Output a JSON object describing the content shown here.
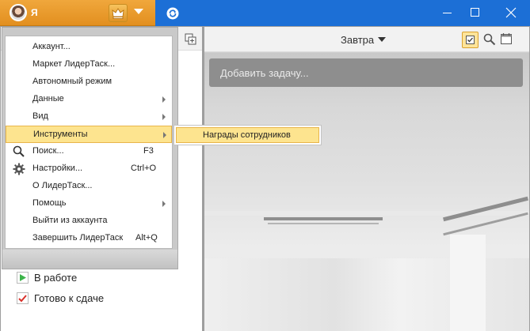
{
  "titlebar": {
    "user_name": "Я",
    "crown_icon": "crown-icon",
    "sync_icon": "sync-icon"
  },
  "menu": {
    "items": [
      {
        "label": "Аккаунт...",
        "shortcut": "",
        "submenu": false,
        "icon": ""
      },
      {
        "label": "Маркет ЛидерТаск...",
        "shortcut": "",
        "submenu": false,
        "icon": ""
      },
      {
        "label": "Автономный режим",
        "shortcut": "",
        "submenu": false,
        "icon": ""
      },
      {
        "label": "Данные",
        "shortcut": "",
        "submenu": true,
        "icon": ""
      },
      {
        "label": "Вид",
        "shortcut": "",
        "submenu": true,
        "icon": ""
      },
      {
        "label": "Инструменты",
        "shortcut": "",
        "submenu": true,
        "icon": "",
        "highlighted": true
      },
      {
        "label": "Поиск...",
        "shortcut": "F3",
        "submenu": false,
        "icon": "search-icon"
      },
      {
        "label": "Настройки...",
        "shortcut": "Ctrl+O",
        "submenu": false,
        "icon": "gear-icon"
      },
      {
        "label": "О ЛидерТаск...",
        "shortcut": "",
        "submenu": false,
        "icon": ""
      },
      {
        "label": "Помощь",
        "shortcut": "",
        "submenu": true,
        "icon": ""
      },
      {
        "label": "Выйти из аккаунта",
        "shortcut": "",
        "submenu": false,
        "icon": ""
      },
      {
        "label": "Завершить ЛидерТаск",
        "shortcut": "Alt+Q",
        "submenu": false,
        "icon": ""
      }
    ]
  },
  "submenu": {
    "item": "Награды сотрудников"
  },
  "left_list": {
    "items": [
      {
        "label": "В работе",
        "icon": "play-icon"
      },
      {
        "label": "Готово к сдаче",
        "icon": "checkmark-icon"
      }
    ]
  },
  "right": {
    "date_label": "Завтра",
    "add_task_placeholder": "Добавить задачу..."
  },
  "colors": {
    "accent": "#e8962a",
    "titlebar": "#1c6fd6",
    "highlight": "#fde48f"
  }
}
